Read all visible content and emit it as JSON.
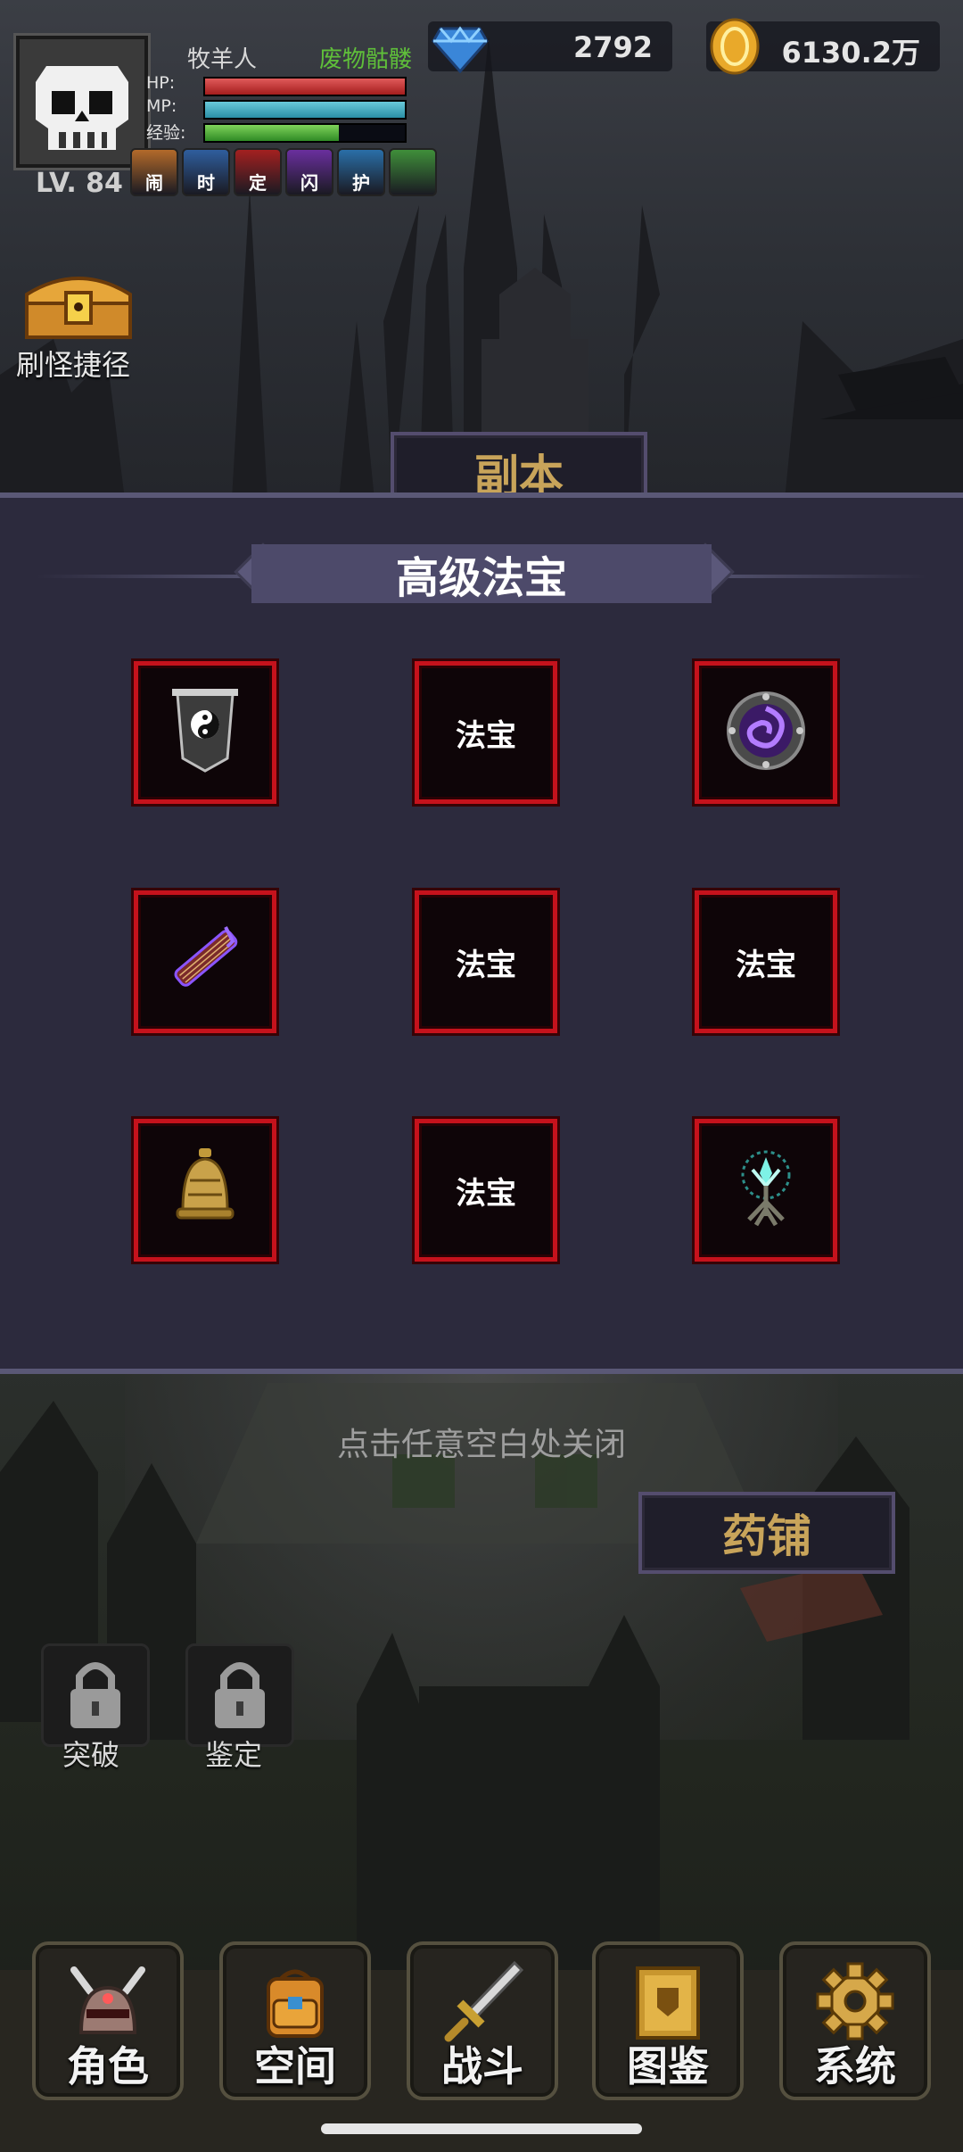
{
  "player": {
    "level": "LV. 84",
    "name": "牧羊人",
    "title": "废物骷髅",
    "hp_label": "HP:",
    "mp_label": "MP:",
    "exp_label": "经验:",
    "hp_fraction": 1.0,
    "mp_fraction": 1.0,
    "exp_fraction": 0.67
  },
  "buffs": [
    {
      "label": "闹",
      "icon": "fist-icon",
      "color": "#b36a2a"
    },
    {
      "label": "时",
      "icon": "hourglass-icon",
      "color": "#2f5e9e"
    },
    {
      "label": "定",
      "icon": "sword-icon",
      "color": "#a32020"
    },
    {
      "label": "闪",
      "icon": "dash-icon",
      "color": "#6a2f9e"
    },
    {
      "label": "护",
      "icon": "shield-icon",
      "color": "#2a6fa8"
    },
    {
      "label": "",
      "icon": "potion-icon",
      "color": "#3f8f3a"
    }
  ],
  "resources": {
    "gems": "2792",
    "gold": "6130.2万"
  },
  "shortcut_label": "刷怪捷径",
  "dungeon_label": "副本",
  "pharmacy_label": "药铺",
  "modal": {
    "title": "高级法宝",
    "slots": [
      {
        "type": "icon",
        "icon": "yin-yang-banner-icon"
      },
      {
        "type": "text",
        "label": "法宝"
      },
      {
        "type": "icon",
        "icon": "purple-vortex-shield-icon"
      },
      {
        "type": "icon",
        "icon": "guqin-icon"
      },
      {
        "type": "text",
        "label": "法宝"
      },
      {
        "type": "text",
        "label": "法宝"
      },
      {
        "type": "icon",
        "icon": "bell-icon"
      },
      {
        "type": "text",
        "label": "法宝"
      },
      {
        "type": "icon",
        "icon": "spirit-tree-icon"
      }
    ]
  },
  "close_hint": "点击任意空白处关闭",
  "locks": [
    {
      "label": "突破"
    },
    {
      "label": "鉴定"
    }
  ],
  "nav": [
    {
      "label": "角色",
      "icon": "helmet-icon"
    },
    {
      "label": "空间",
      "icon": "backpack-icon"
    },
    {
      "label": "战斗",
      "icon": "sword-icon"
    },
    {
      "label": "图鉴",
      "icon": "book-icon"
    },
    {
      "label": "系统",
      "icon": "gear-icon"
    }
  ]
}
